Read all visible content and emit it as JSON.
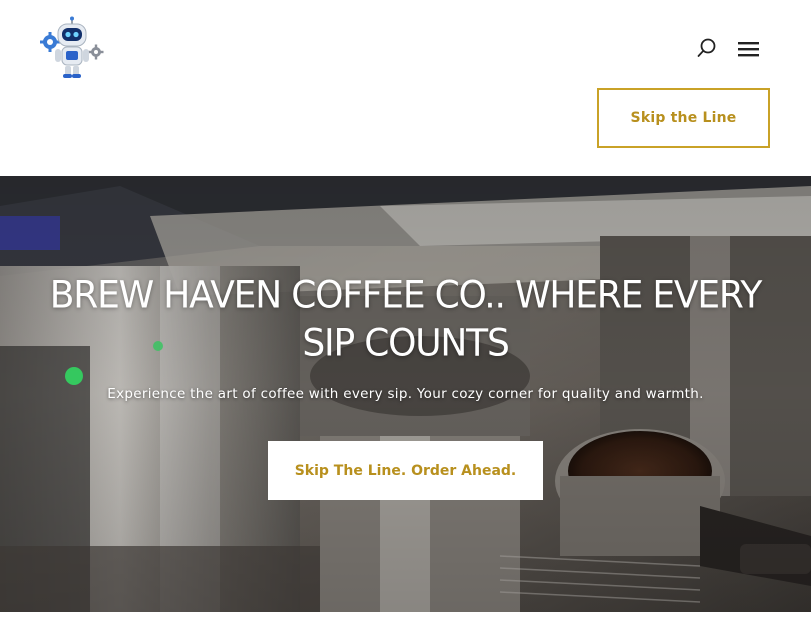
{
  "header": {
    "skip_button_label": "Skip the Line"
  },
  "hero": {
    "title": "BREW HAVEN COFFEE CO.. WHERE EVERY SIP COUNTS",
    "subtitle": "Experience the art of coffee with every sip. Your cozy corner for quality and warmth.",
    "cta_label": "Skip The Line. Order Ahead."
  },
  "icons": {
    "logo": "robot-mascot-logo",
    "search": "search-icon",
    "menu": "hamburger-menu-icon"
  },
  "colors": {
    "accent_gold": "#c9a227",
    "accent_text": "#b8901e",
    "hero_text": "#ffffff"
  }
}
